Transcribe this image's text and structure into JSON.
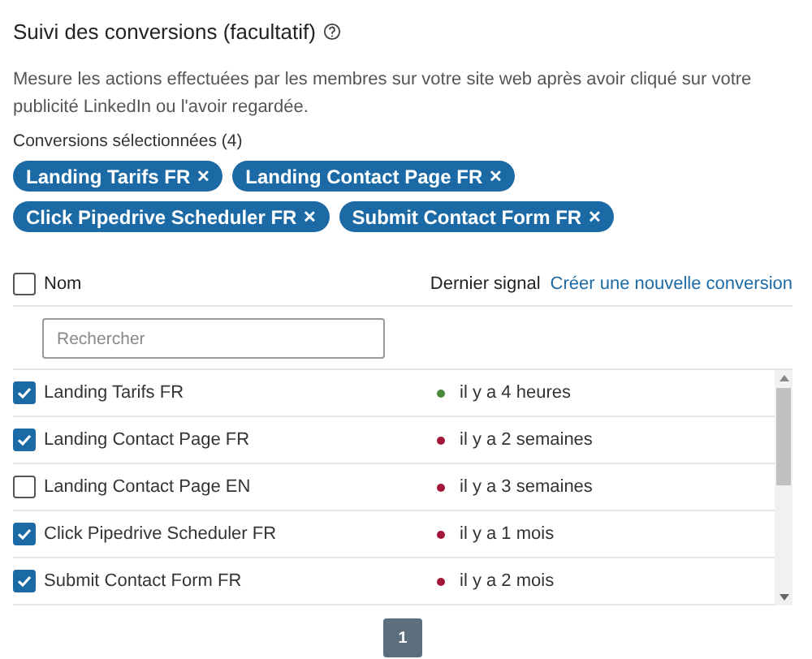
{
  "section": {
    "title": "Suivi des conversions (facultatif)",
    "description": "Mesure les actions effectuées par les membres sur votre site web après avoir cliqué sur votre publicité LinkedIn ou l'avoir regardée.",
    "selected_label": "Conversions sélectionnées (4)"
  },
  "chips": [
    {
      "label": "Landing Tarifs FR",
      "remove": "✕"
    },
    {
      "label": "Landing Contact Page FR",
      "remove": "✕"
    },
    {
      "label": "Click Pipedrive Scheduler FR",
      "remove": "✕"
    },
    {
      "label": "Submit Contact Form FR",
      "remove": "✕"
    }
  ],
  "table": {
    "select_all": {
      "checked": false
    },
    "columns": [
      "Nom",
      "Dernier signal"
    ],
    "create_link": "Créer une nouvelle conversion",
    "search": {
      "placeholder": "Rechercher"
    },
    "rows": [
      {
        "name": "Landing Tarifs FR",
        "checked": true,
        "color": "#4a8a3a",
        "last_signal": "il y a 4 heures"
      },
      {
        "name": "Landing Contact Page FR",
        "checked": true,
        "color": "#a3173a",
        "last_signal": "il y a 2 semaines"
      },
      {
        "name": "Landing Contact Page EN",
        "checked": false,
        "color": "#a3173a",
        "last_signal": "il y a 3 semaines"
      },
      {
        "name": "Click Pipedrive Scheduler FR",
        "checked": true,
        "color": "#a3173a",
        "last_signal": "il y a 1 mois"
      },
      {
        "name": "Submit Contact Form FR",
        "checked": true,
        "color": "#a3173a",
        "last_signal": "il y a 2 mois"
      }
    ]
  },
  "pagination": {
    "pages": [
      {
        "label": "1",
        "selected": true
      }
    ]
  }
}
